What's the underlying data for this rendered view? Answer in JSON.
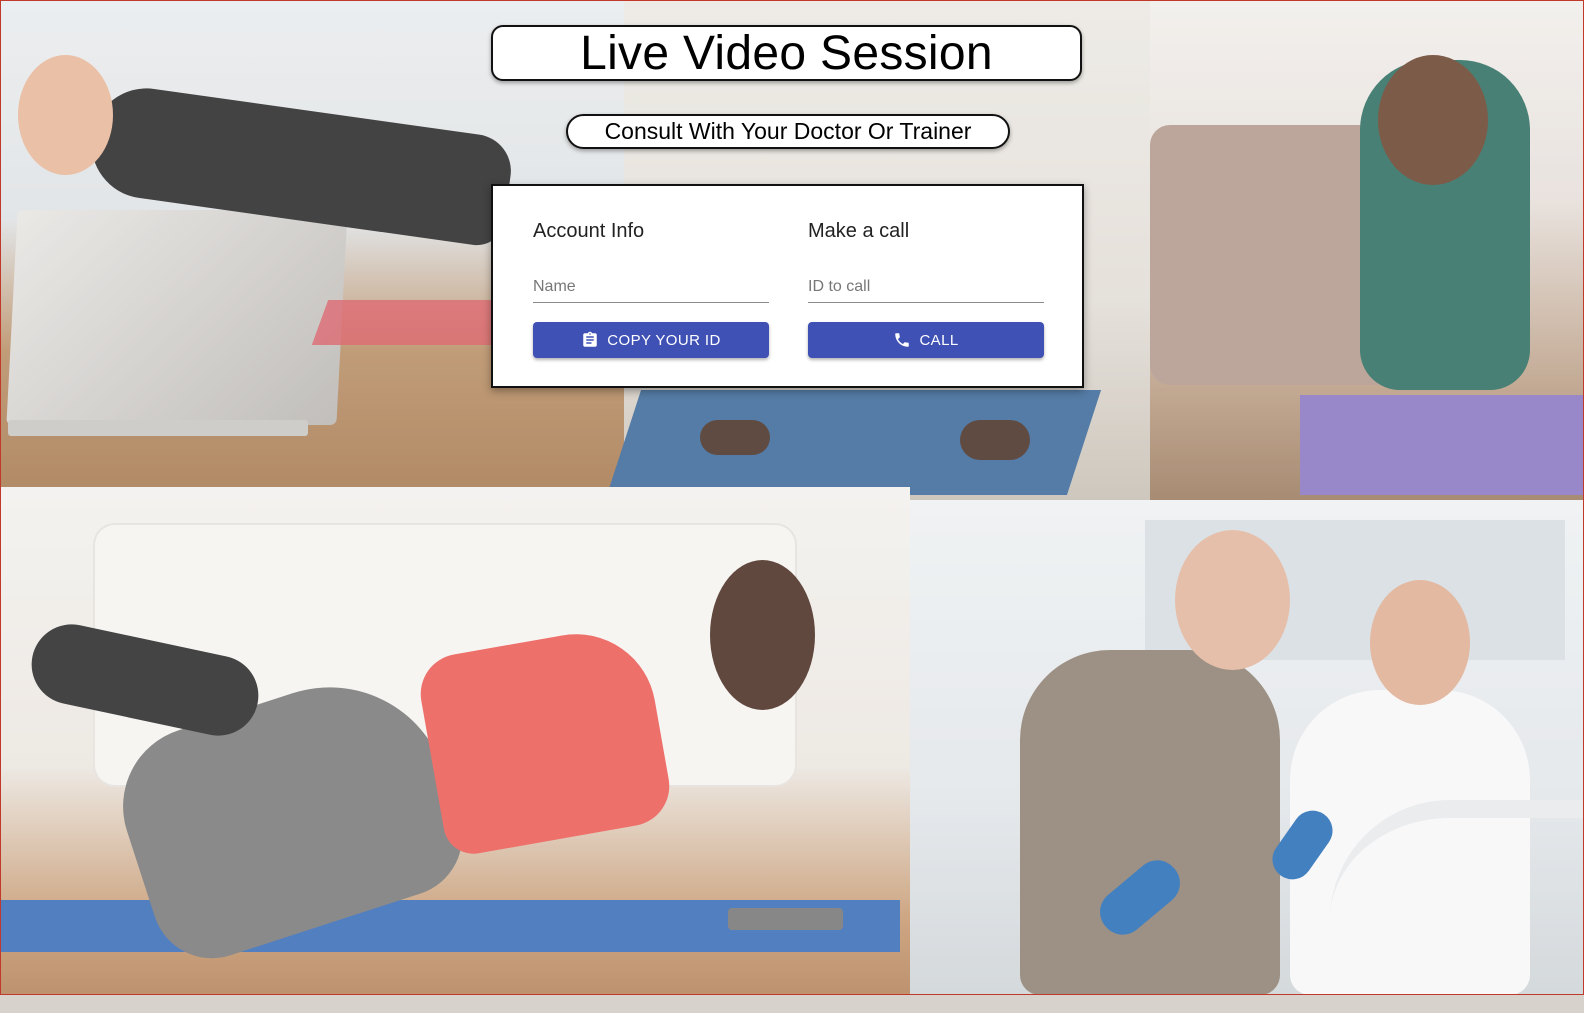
{
  "header": {
    "title": "Live Video Session",
    "subtitle": "Consult With Your Doctor Or Trainer"
  },
  "account": {
    "heading": "Account Info",
    "name_placeholder": "Name",
    "copy_button_label": "COPY YOUR ID",
    "copy_icon": "clipboard-icon"
  },
  "call": {
    "heading": "Make a call",
    "id_placeholder": "ID to call",
    "call_button_label": "CALL",
    "call_icon": "phone-icon"
  },
  "colors": {
    "primary": "#3f51b5",
    "border": "#111111",
    "page_frame": "#c0392b"
  }
}
